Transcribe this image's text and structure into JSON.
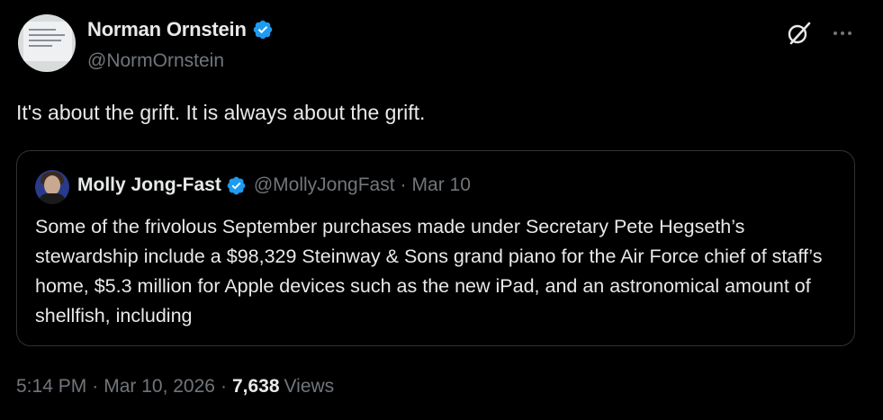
{
  "author": {
    "display_name": "Norman Ornstein",
    "handle": "@NormOrnstein",
    "verified": true
  },
  "icons": {
    "verified": "verified-badge-icon",
    "grok": "grok-icon",
    "more": "more-options-icon"
  },
  "tweet": {
    "text": "It's about the grift. It is always about the grift."
  },
  "quoted_tweet": {
    "display_name": "Molly Jong-Fast",
    "handle": "@MollyJongFast",
    "separator": "·",
    "date": "Mar 10",
    "text": "Some of the frivolous September purchases made under Secretary Pete Hegseth’s stewardship include a $98,329 Steinway & Sons grand piano for the Air Force chief of staff’s home, $5.3 million for Apple devices such as the new iPad, and an astronomical amount of shellfish, including"
  },
  "meta": {
    "time": "5:14 PM",
    "separator": "·",
    "date": "Mar 10, 2026",
    "views_count": "7,638",
    "views_label": "Views"
  },
  "colors": {
    "background": "#000000",
    "text_primary": "#e7e9ea",
    "text_secondary": "#71767b",
    "border": "#2f3336",
    "verified_blue": "#1d9bf0"
  }
}
